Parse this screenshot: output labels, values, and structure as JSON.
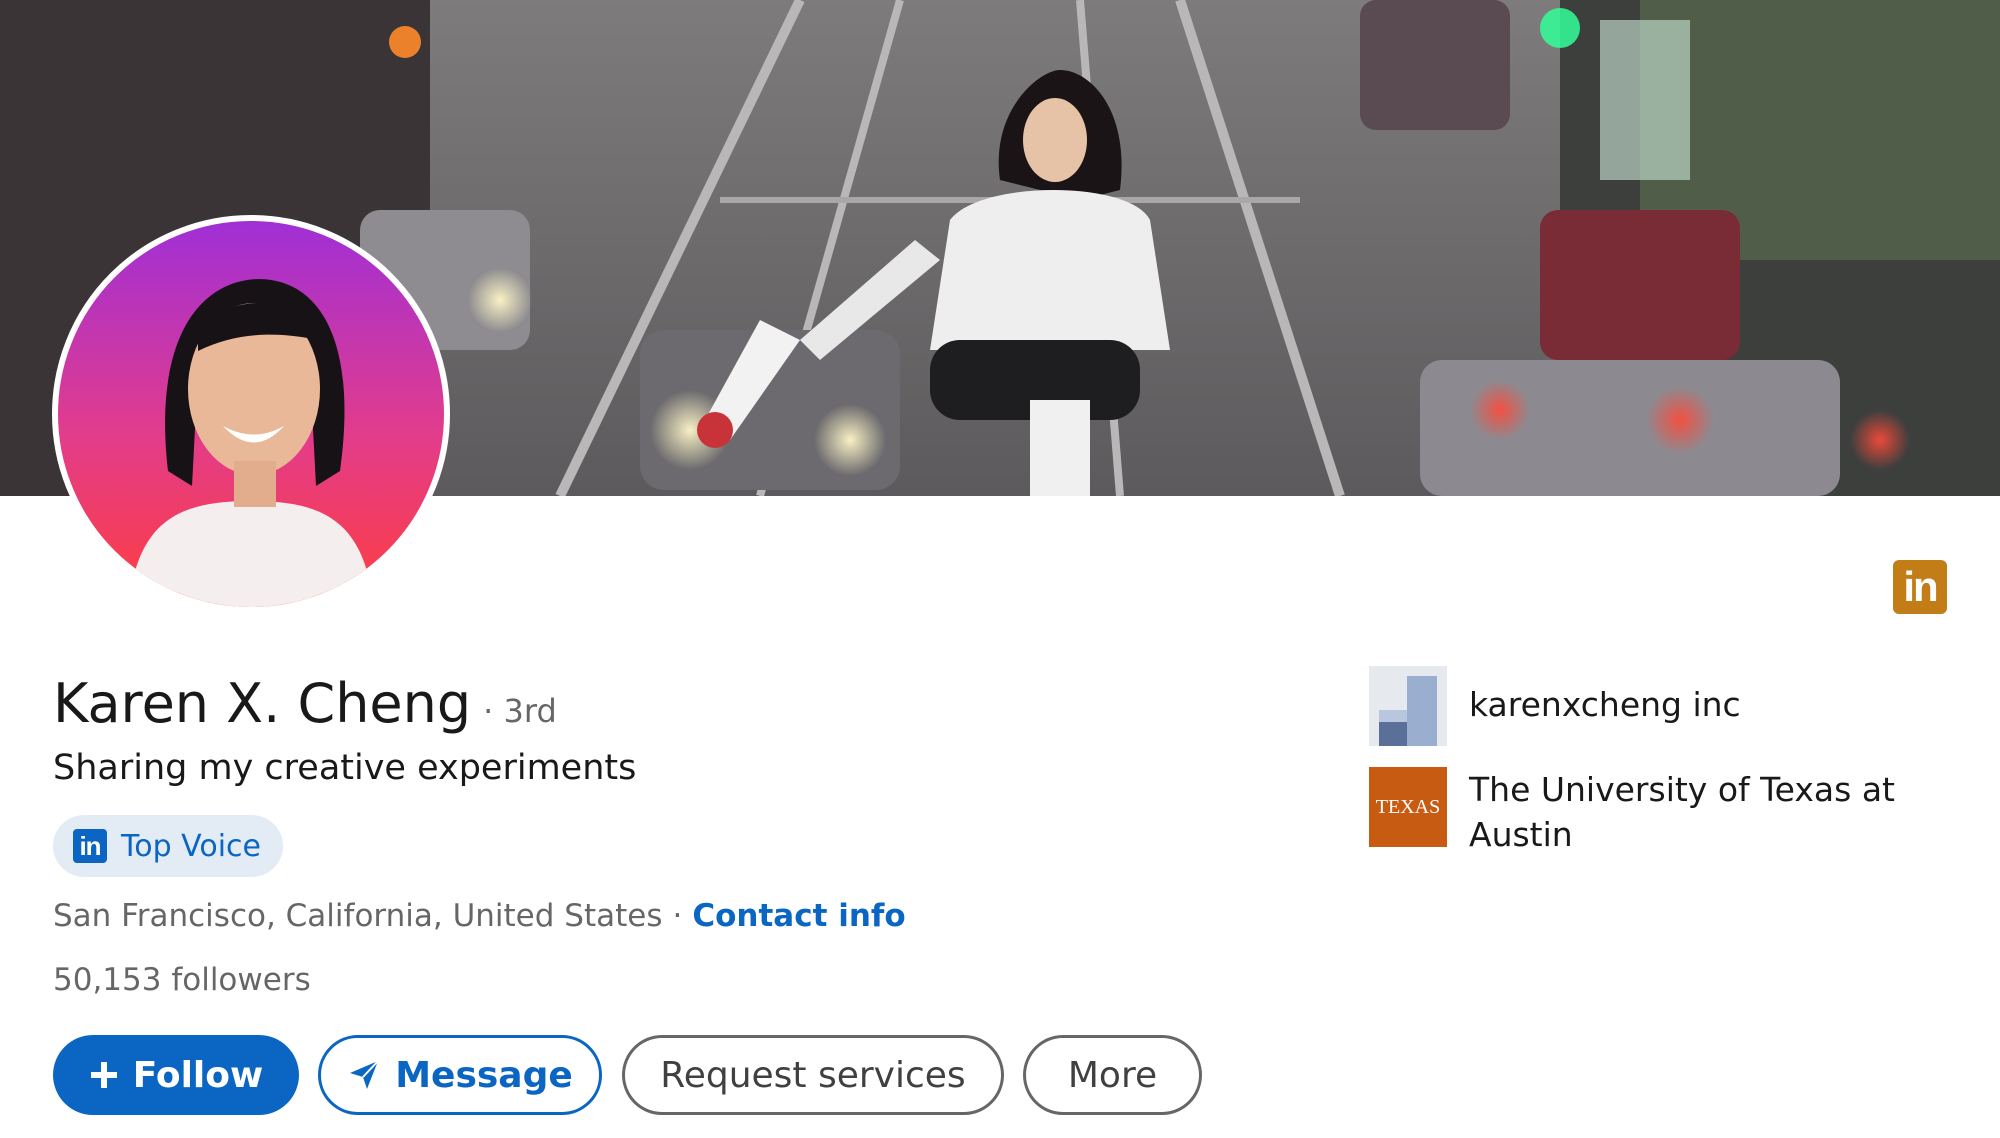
{
  "profile": {
    "name": "Karen X. Cheng",
    "degree": "· 3rd",
    "headline": "Sharing my creative experiments",
    "badge_label": "Top Voice",
    "location": "San Francisco, California, United States",
    "separator": "·",
    "contact_label": "Contact info",
    "followers": "50,153 followers"
  },
  "actions": {
    "follow_label": "Follow",
    "message_label": "Message",
    "request_label": "Request services",
    "more_label": "More"
  },
  "organizations": [
    {
      "name": "karenxcheng inc"
    },
    {
      "name": "The University of Texas at Austin",
      "logo_text": "TEXAS"
    }
  ],
  "icons": {
    "linkedin_corner": "linkedin-icon",
    "top_voice": "linkedin-icon",
    "follow": "plus-icon",
    "message": "send-icon"
  },
  "colors": {
    "accent": "#0a66c2",
    "badge_bg": "#e3ecf5",
    "corner_badge": "#c37d16",
    "texas": "#c75b12"
  }
}
